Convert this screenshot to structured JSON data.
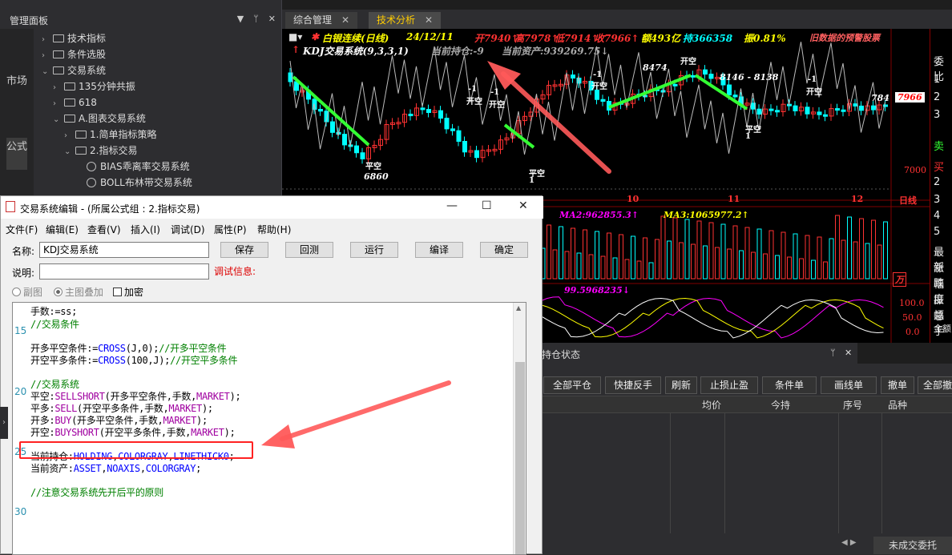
{
  "manager": {
    "title": "管理面板",
    "side_tabs": [
      "市场",
      "公式"
    ],
    "tree": [
      {
        "label": "技术指标",
        "level": 1,
        "type": "folder"
      },
      {
        "label": "条件选股",
        "level": 1,
        "type": "folder"
      },
      {
        "label": "交易系统",
        "level": 1,
        "type": "folder",
        "expanded": true
      },
      {
        "label": "135分钟共振",
        "level": 2,
        "type": "folder"
      },
      {
        "label": "618",
        "level": 2,
        "type": "folder"
      },
      {
        "label": "A.图表交易系统",
        "level": 2,
        "type": "folder",
        "expanded": true
      },
      {
        "label": "1.简单指标策略",
        "level": 3,
        "type": "folder"
      },
      {
        "label": "2.指标交易",
        "level": 3,
        "type": "folder",
        "expanded": true
      },
      {
        "label": "BIAS乖离率交易系统",
        "level": 4,
        "type": "item"
      },
      {
        "label": "BOLL布林带交易系统",
        "level": 4,
        "type": "item"
      }
    ]
  },
  "tabs": [
    {
      "label": "综合管理",
      "active": false
    },
    {
      "label": "技术分析",
      "active": true
    }
  ],
  "chart": {
    "header1": {
      "name": "白银连续(日线)",
      "date": "24/12/11",
      "open": "开7940↑",
      "high": "高7978↑",
      "low": "低7914↑",
      "close": "收7966↑",
      "amount": "额493亿",
      "hold": "持366358",
      "range": "振0.81%",
      "extra": "旧数据的预警股票"
    },
    "header2": {
      "system": "KDJ交易系统(9,3,3,1)",
      "holding": "当前持仓:-9",
      "asset": "当前资产:939269.75↓"
    },
    "annotations": {
      "low_price": "6860",
      "high_price": "8474",
      "range_text": "8146 - 8138",
      "last_price": "7966",
      "last_price2": "784",
      "ytick": "7000",
      "months": [
        "10",
        "11",
        "12"
      ],
      "period": "日线",
      "signal_open_short": "开空",
      "signal_close_short": "平空",
      "minus_one": "-1",
      "one": "1"
    },
    "vol_legend": {
      "ma2": "MA2:962855.3↑",
      "ma3": "MA3:1065977.2↑",
      "unit": "万"
    },
    "kdj_legend": "99.5968235↓",
    "kdj_ticks": [
      "100.0",
      "50.0",
      "0.0"
    ],
    "colors": {
      "up": "#ff3232",
      "down": "#00ffff",
      "signal_line": "#33ff33",
      "price": "#ffff00"
    }
  },
  "order_panel": {
    "label": "委比",
    "rows": [
      "1",
      "2",
      "3",
      "卖",
      "买",
      "2",
      "3",
      "4",
      "5"
    ],
    "bottom": [
      "最新",
      "涨跌",
      "幅度",
      "振幅",
      "总手",
      "金额"
    ]
  },
  "trade_panel": {
    "title": "持仓状态",
    "buttons": [
      "全部平仓",
      "快捷反手",
      "刷新",
      "止损止盈",
      "条件单",
      "画线单",
      "撤单",
      "全部撤"
    ],
    "columns": [
      "均价",
      "今持",
      "序号",
      "品种"
    ],
    "bottom_tab": "未成交委托"
  },
  "dialog": {
    "title": "交易系统编辑 - (所属公式组 : 2.指标交易)",
    "menu": [
      "文件(F)",
      "编辑(E)",
      "查看(V)",
      "插入(I)",
      "调试(D)",
      "属性(P)",
      "帮助(H)"
    ],
    "name_label": "名称:",
    "name_value": "KDJ交易系统",
    "desc_label": "说明:",
    "desc_value": "",
    "debug_label": "调试信息:",
    "buttons": [
      "保存",
      "回测",
      "运行",
      "编译",
      "确定"
    ],
    "radio_sub": "副图",
    "radio_main": "主图叠加",
    "check_encrypt": "加密",
    "line_numbers": [
      "15",
      "20",
      "25",
      "30"
    ],
    "code": [
      [
        {
          "t": "手数:=ss;",
          "c": "blk"
        }
      ],
      [
        {
          "t": "//交易条件",
          "c": "grn"
        }
      ],
      [],
      [
        {
          "t": "开多平空条件:=",
          "c": "blk"
        },
        {
          "t": "CROSS",
          "c": "blu"
        },
        {
          "t": "(J,0);",
          "c": "blk"
        },
        {
          "t": "//开多平空条件",
          "c": "grn"
        }
      ],
      [
        {
          "t": "开空平多条件:=",
          "c": "blk"
        },
        {
          "t": "CROSS",
          "c": "blu"
        },
        {
          "t": "(100,J);",
          "c": "blk"
        },
        {
          "t": "//开空平多条件",
          "c": "grn"
        }
      ],
      [],
      [
        {
          "t": "//交易系统",
          "c": "grn"
        }
      ],
      [
        {
          "t": "平空:",
          "c": "blk"
        },
        {
          "t": "SELLSHORT",
          "c": "pur"
        },
        {
          "t": "(开多平空条件,手数,",
          "c": "blk"
        },
        {
          "t": "MARKET",
          "c": "pur"
        },
        {
          "t": ");",
          "c": "blk"
        }
      ],
      [
        {
          "t": "平多:",
          "c": "blk"
        },
        {
          "t": "SELL",
          "c": "pur"
        },
        {
          "t": "(开空平多条件,手数,",
          "c": "blk"
        },
        {
          "t": "MARKET",
          "c": "pur"
        },
        {
          "t": ");",
          "c": "blk"
        }
      ],
      [
        {
          "t": "开多:",
          "c": "blk"
        },
        {
          "t": "BUY",
          "c": "pur"
        },
        {
          "t": "(开多平空条件,手数,",
          "c": "blk"
        },
        {
          "t": "MARKET",
          "c": "pur"
        },
        {
          "t": ");",
          "c": "blk"
        }
      ],
      [
        {
          "t": "开空:",
          "c": "blk"
        },
        {
          "t": "BUYSHORT",
          "c": "pur"
        },
        {
          "t": "(开空平多条件,手数,",
          "c": "blk"
        },
        {
          "t": "MARKET",
          "c": "pur"
        },
        {
          "t": ");",
          "c": "blk"
        }
      ],
      [],
      [
        {
          "t": "当前持仓:",
          "c": "blk"
        },
        {
          "t": "HOLDING",
          "c": "blu"
        },
        {
          "t": ",",
          "c": "blk"
        },
        {
          "t": "COLORGRAY",
          "c": "blu"
        },
        {
          "t": ",",
          "c": "blk"
        },
        {
          "t": "LINETHICK0",
          "c": "blu"
        },
        {
          "t": ";",
          "c": "blk"
        }
      ],
      [
        {
          "t": "当前资产:",
          "c": "blk"
        },
        {
          "t": "ASSET",
          "c": "blu"
        },
        {
          "t": ",",
          "c": "blk"
        },
        {
          "t": "NOAXIS",
          "c": "blu"
        },
        {
          "t": ",",
          "c": "blk"
        },
        {
          "t": "COLORGRAY",
          "c": "blu"
        },
        {
          "t": ";",
          "c": "blk"
        }
      ],
      [],
      [
        {
          "t": "//注意交易系统先开后平的原则",
          "c": "grn"
        }
      ]
    ]
  }
}
